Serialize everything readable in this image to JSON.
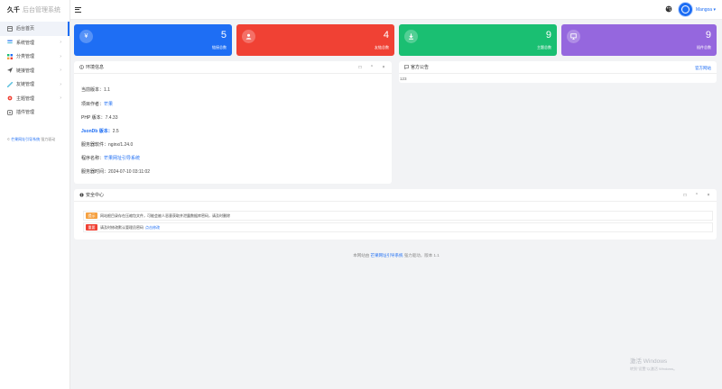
{
  "brand": {
    "mark": "久千",
    "name": "后台管理系统"
  },
  "sidebar": {
    "items": [
      {
        "label": "后台首页",
        "icon": "dashboard-icon",
        "active": true,
        "has_children": false
      },
      {
        "label": "系统管理",
        "icon": "settings-icon",
        "active": false,
        "has_children": true
      },
      {
        "label": "分类管理",
        "icon": "category-icon",
        "active": false,
        "has_children": true
      },
      {
        "label": "链接管理",
        "icon": "send-icon",
        "active": false,
        "has_children": true
      },
      {
        "label": "友链管理",
        "icon": "link-icon",
        "active": false,
        "has_children": true
      },
      {
        "label": "主题管理",
        "icon": "theme-icon",
        "active": false,
        "has_children": true
      },
      {
        "label": "插件管理",
        "icon": "plugin-icon",
        "active": false,
        "has_children": false
      }
    ],
    "footer_link": "芒果网址引导系统",
    "footer_text": "强力驱动"
  },
  "header": {
    "username": "Mangoa"
  },
  "stats": [
    {
      "value": "5",
      "label": "链接总数",
      "color": "#1e6ef4",
      "icon": "yen-icon"
    },
    {
      "value": "4",
      "label": "友链总数",
      "color": "#f04134",
      "icon": "user-icon"
    },
    {
      "value": "9",
      "label": "主题总数",
      "color": "#1abf72",
      "icon": "download-icon"
    },
    {
      "value": "9",
      "label": "插件总数",
      "color": "#9567de",
      "icon": "monitor-icon"
    }
  ],
  "env": {
    "title": "环境信息",
    "rows": [
      {
        "key": "当前版本：",
        "value": "1.1"
      },
      {
        "key": "项目作者：",
        "value": "芒果"
      },
      {
        "key": "PHP 版本：",
        "value": "7.4.33"
      },
      {
        "key": "JsonDb 版本：",
        "value": "2.5"
      },
      {
        "key": "服务器软件：",
        "value": "nginx/1.24.0"
      },
      {
        "key": "程序名称：",
        "value": "芒果网址引导系统"
      },
      {
        "key": "服务器时间：",
        "value": "2024-07-10 03:11:02"
      }
    ]
  },
  "notice": {
    "title": "官方公告",
    "more": "官方网站",
    "content": "123"
  },
  "security": {
    "title": "安全中心",
    "alerts": [
      {
        "tag": "提示",
        "color": "#f5a142",
        "text": "网站根目录存在压缩包文件，可能会被人恶意获取并泄露数据库密码，请及时删除",
        "action": ""
      },
      {
        "tag": "重要",
        "color": "#f04134",
        "text": "请及时修改默认管理员密码",
        "action": "点击修改"
      }
    ]
  },
  "footer": {
    "prefix": "本网站由",
    "link": "芒果网址引导系统",
    "suffix": "强力驱动，版本 1.1"
  },
  "watermark": {
    "line1": "激活 Windows",
    "line2": "转到\"设置\"以激活 Windows。"
  }
}
